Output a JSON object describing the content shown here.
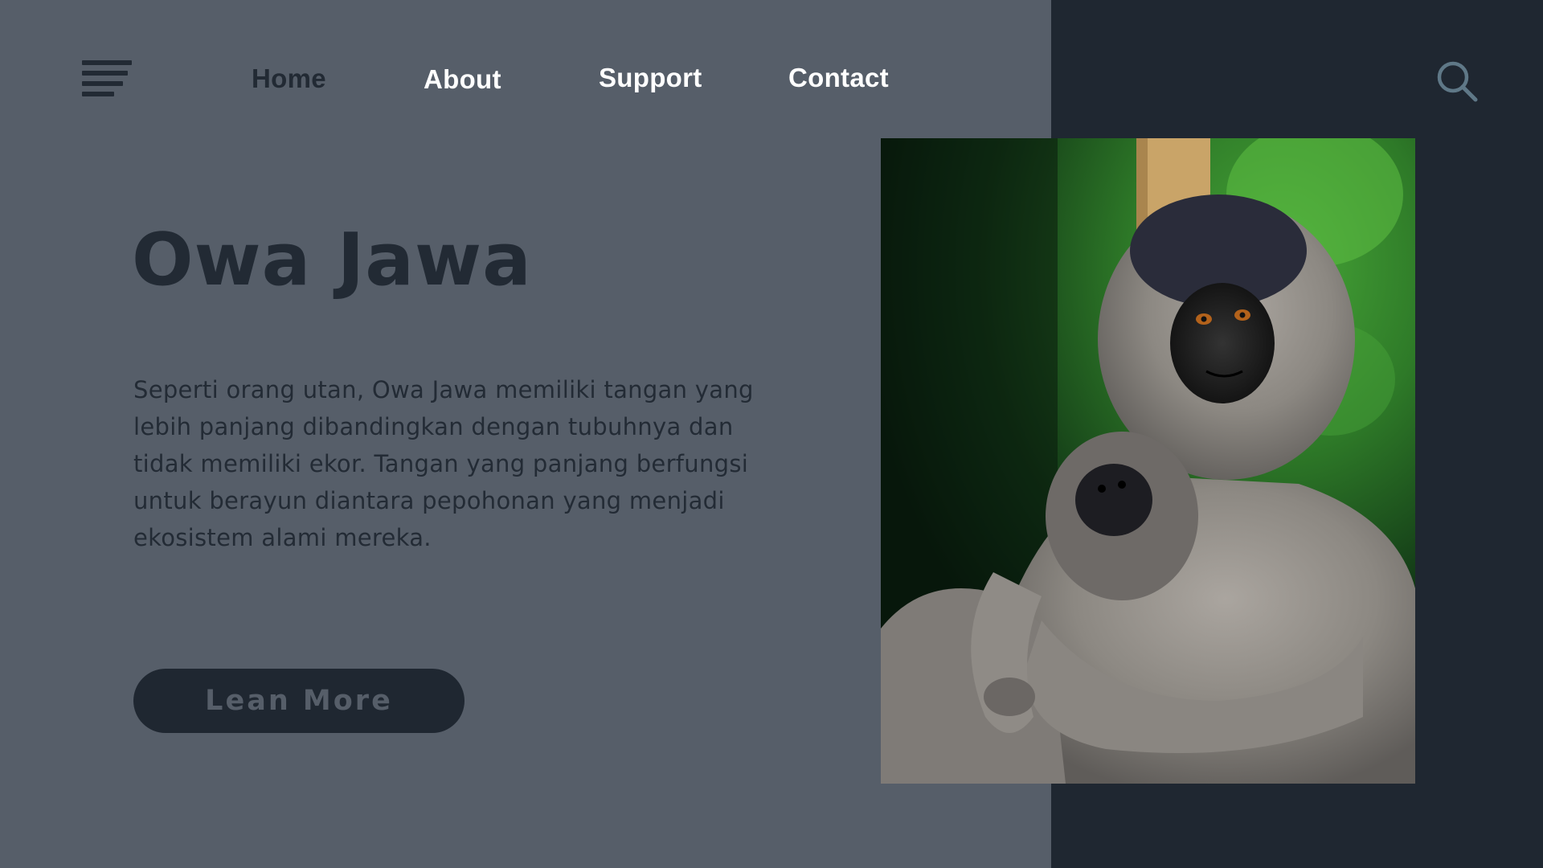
{
  "nav": {
    "home": "Home",
    "about": "About",
    "support": "Support",
    "contact": "Contact"
  },
  "hero": {
    "title": "Owa Jawa",
    "description": "Seperti orang utan, Owa Jawa memiliki tangan yang lebih panjang dibandingkan dengan tubuhnya dan tidak memiliki ekor. Tangan yang panjang berfungsi untuk berayun diantara pepohonan yang menjadi ekosistem alami mereka.",
    "button_label": "Lean More"
  },
  "icons": {
    "menu": "hamburger-menu-icon",
    "search": "search-icon"
  },
  "colors": {
    "left_background": "#565e69",
    "right_background": "#1f2731",
    "dark_text": "#222a34",
    "nav_text": "#ffffff",
    "search_icon": "#5f7887"
  },
  "image": {
    "subject": "Javan gibbon with baby"
  }
}
